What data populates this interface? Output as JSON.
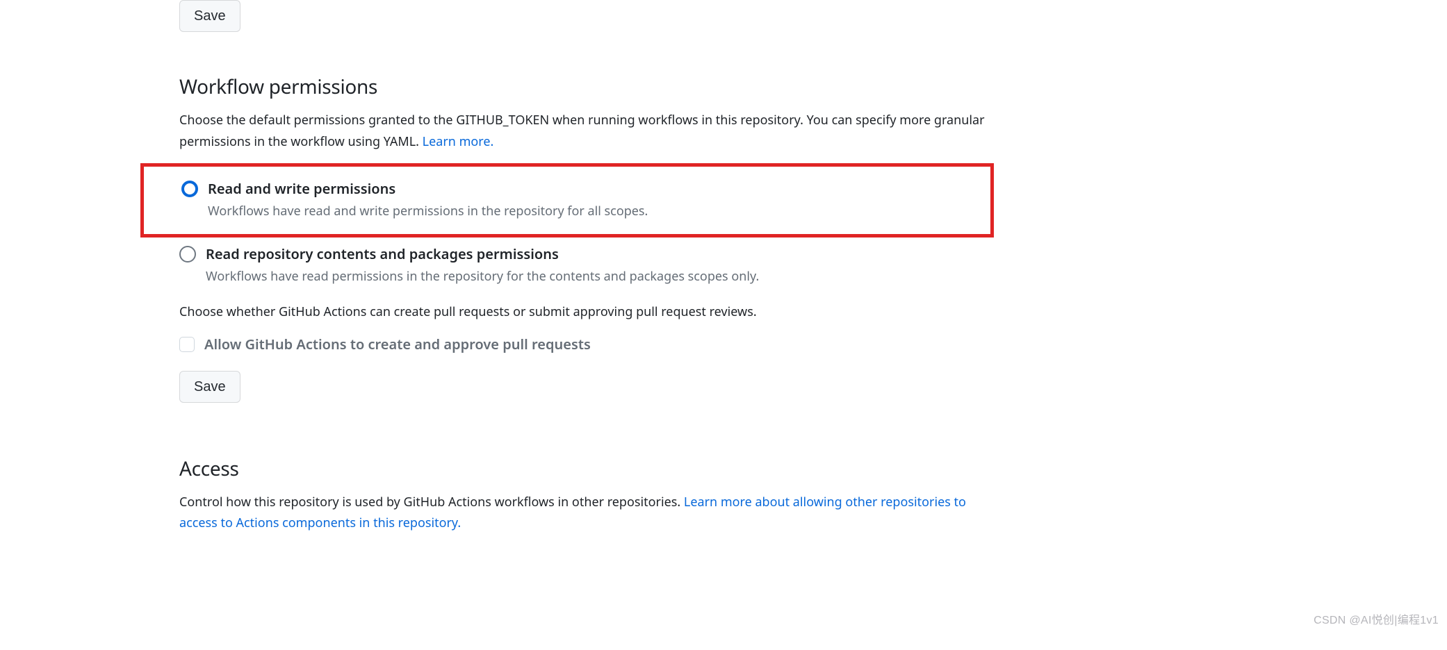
{
  "save_top": "Save",
  "workflow": {
    "heading": "Workflow permissions",
    "intro_a": "Choose the default permissions granted to the GITHUB_TOKEN when running workflows in this repository. You can specify more granular permissions in the workflow using YAML. ",
    "learn_more": "Learn more.",
    "option1": {
      "label": "Read and write permissions",
      "desc": "Workflows have read and write permissions in the repository for all scopes."
    },
    "option2": {
      "label": "Read repository contents and packages permissions",
      "desc": "Workflows have read permissions in the repository for the contents and packages scopes only."
    },
    "pr_intro": "Choose whether GitHub Actions can create pull requests or submit approving pull request reviews.",
    "checkbox_label": "Allow GitHub Actions to create and approve pull requests",
    "save_bottom": "Save"
  },
  "access": {
    "heading": "Access",
    "intro_a": "Control how this repository is used by GitHub Actions workflows in other repositories. ",
    "link": "Learn more about allowing other repositories to access to Actions components in this repository."
  },
  "watermark": "CSDN @AI悦创|编程1v1"
}
